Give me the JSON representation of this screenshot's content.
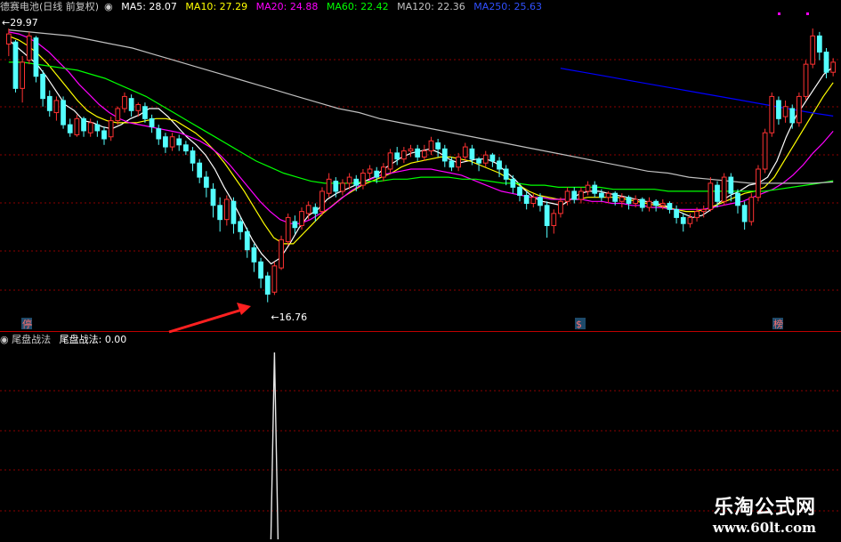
{
  "header": {
    "stock_title": "德赛电池(日线 前复权)",
    "ma_items": [
      {
        "label": "MA5",
        "value": "28.07",
        "color": "#ffffff"
      },
      {
        "label": "MA10",
        "value": "27.29",
        "color": "#ffff00"
      },
      {
        "label": "MA20",
        "value": "24.88",
        "color": "#ff00ff"
      },
      {
        "label": "MA60",
        "value": "22.42",
        "color": "#00ff00"
      },
      {
        "label": "MA120",
        "value": "22.36",
        "color": "#c0c0c0"
      },
      {
        "label": "MA250",
        "value": "25.63",
        "color": "#0000ff"
      }
    ]
  },
  "price_labels": {
    "high": "29.97",
    "low": "16.76"
  },
  "markers": {
    "left_badge": "停",
    "mid_badge": "$",
    "right_badge": "榜"
  },
  "indicator": {
    "name": "尾盘战法",
    "value_label": "尾盘战法",
    "value": "0.00"
  },
  "watermark": {
    "line1": "乐淘公式网",
    "line2": "www.60lt.com"
  },
  "colors": {
    "up": "#ff3232",
    "down": "#54ffff",
    "grid": "#8b0000",
    "divider": "#c00000",
    "arrow": "#ff2020"
  },
  "chart_data": {
    "type": "candlestick",
    "ylim": [
      15.5,
      30.5
    ],
    "grid": true,
    "candles": [
      [
        29.2,
        29.7,
        28.6,
        29.97
      ],
      [
        29.3,
        27.0,
        26.8,
        29.4
      ],
      [
        27.0,
        28.3,
        26.3,
        28.6
      ],
      [
        28.4,
        29.6,
        28.2,
        29.8
      ],
      [
        29.5,
        27.6,
        27.3,
        29.6
      ],
      [
        27.7,
        26.5,
        26.1,
        27.9
      ],
      [
        26.6,
        25.9,
        25.6,
        26.9
      ],
      [
        25.8,
        26.4,
        25.4,
        26.6
      ],
      [
        26.4,
        25.2,
        25.0,
        26.6
      ],
      [
        25.2,
        24.8,
        24.6,
        25.5
      ],
      [
        24.7,
        25.5,
        24.6,
        25.7
      ],
      [
        25.5,
        24.9,
        24.6,
        25.6
      ],
      [
        24.8,
        25.3,
        24.6,
        25.5
      ],
      [
        25.2,
        24.9,
        24.6,
        25.4
      ],
      [
        24.9,
        24.5,
        24.2,
        25.1
      ],
      [
        24.6,
        25.4,
        24.4,
        25.6
      ],
      [
        25.4,
        26.0,
        25.2,
        26.1
      ],
      [
        26.0,
        26.6,
        25.8,
        26.8
      ],
      [
        26.5,
        25.9,
        25.6,
        26.7
      ],
      [
        25.9,
        26.2,
        25.6,
        26.3
      ],
      [
        26.1,
        25.5,
        25.3,
        26.3
      ],
      [
        25.5,
        25.1,
        24.8,
        25.7
      ],
      [
        25.0,
        24.5,
        24.2,
        25.2
      ],
      [
        24.6,
        24.1,
        23.8,
        24.8
      ],
      [
        24.1,
        24.6,
        23.9,
        24.8
      ],
      [
        24.5,
        24.2,
        23.9,
        24.7
      ],
      [
        24.2,
        23.9,
        23.7,
        24.4
      ],
      [
        23.9,
        23.3,
        22.9,
        24.1
      ],
      [
        23.3,
        22.6,
        22.3,
        23.5
      ],
      [
        22.6,
        22.1,
        21.6,
        22.9
      ],
      [
        22.0,
        21.2,
        20.6,
        22.3
      ],
      [
        21.2,
        20.5,
        19.9,
        21.6
      ],
      [
        20.5,
        21.5,
        20.2,
        21.7
      ],
      [
        21.4,
        20.3,
        19.8,
        21.6
      ],
      [
        20.4,
        19.9,
        19.5,
        20.6
      ],
      [
        19.9,
        19.0,
        18.6,
        20.1
      ],
      [
        19.1,
        18.4,
        17.9,
        19.3
      ],
      [
        18.4,
        17.6,
        17.1,
        18.6
      ],
      [
        17.7,
        16.8,
        16.4,
        17.9
      ],
      [
        16.9,
        18.2,
        16.76,
        18.4
      ],
      [
        18.1,
        19.5,
        18.0,
        19.7
      ],
      [
        19.4,
        20.6,
        19.2,
        20.8
      ],
      [
        20.4,
        20.1,
        19.8,
        20.7
      ],
      [
        20.2,
        20.9,
        20.0,
        21.1
      ],
      [
        20.8,
        21.2,
        20.5,
        21.4
      ],
      [
        21.1,
        20.8,
        20.4,
        21.3
      ],
      [
        20.9,
        21.9,
        20.7,
        22.1
      ],
      [
        21.8,
        22.5,
        21.6,
        22.8
      ],
      [
        22.4,
        21.9,
        21.6,
        22.6
      ],
      [
        21.9,
        22.3,
        21.7,
        22.5
      ],
      [
        22.3,
        22.6,
        22.0,
        22.8
      ],
      [
        22.5,
        22.2,
        21.9,
        22.7
      ],
      [
        22.2,
        22.8,
        22.0,
        23.0
      ],
      [
        22.8,
        23.0,
        22.5,
        23.2
      ],
      [
        22.9,
        22.6,
        22.3,
        23.1
      ],
      [
        22.6,
        23.1,
        22.4,
        23.3
      ],
      [
        23.0,
        23.8,
        22.8,
        24.0
      ],
      [
        23.8,
        23.5,
        23.2,
        24.1
      ],
      [
        23.5,
        23.9,
        23.3,
        24.1
      ],
      [
        23.9,
        24.0,
        23.6,
        24.2
      ],
      [
        24.0,
        23.6,
        23.4,
        24.2
      ],
      [
        23.6,
        23.9,
        23.4,
        24.2
      ],
      [
        23.9,
        24.4,
        23.7,
        24.6
      ],
      [
        24.3,
        24.0,
        23.6,
        24.5
      ],
      [
        24.0,
        23.4,
        23.1,
        24.2
      ],
      [
        23.4,
        23.1,
        22.9,
        23.6
      ],
      [
        23.1,
        23.6,
        22.9,
        23.8
      ],
      [
        23.6,
        24.1,
        23.4,
        24.3
      ],
      [
        24.0,
        23.5,
        23.2,
        24.2
      ],
      [
        23.5,
        23.3,
        22.9,
        23.6
      ],
      [
        23.3,
        23.7,
        23.1,
        23.9
      ],
      [
        23.7,
        23.4,
        23.1,
        23.8
      ],
      [
        23.4,
        23.0,
        22.6,
        23.6
      ],
      [
        23.0,
        22.5,
        22.2,
        23.2
      ],
      [
        22.5,
        22.1,
        21.8,
        22.7
      ],
      [
        22.1,
        21.7,
        21.4,
        22.3
      ],
      [
        21.7,
        21.3,
        21.0,
        21.9
      ],
      [
        21.3,
        21.6,
        21.1,
        21.8
      ],
      [
        21.6,
        21.2,
        20.9,
        21.8
      ],
      [
        21.2,
        20.2,
        19.6,
        21.4
      ],
      [
        20.2,
        20.8,
        19.8,
        21.0
      ],
      [
        20.8,
        21.4,
        20.6,
        21.6
      ],
      [
        21.4,
        21.9,
        21.2,
        22.1
      ],
      [
        21.9,
        21.5,
        21.3,
        22.1
      ],
      [
        21.5,
        21.9,
        21.3,
        22.1
      ],
      [
        21.9,
        22.2,
        21.7,
        22.4
      ],
      [
        22.2,
        21.8,
        21.6,
        22.4
      ],
      [
        21.8,
        21.6,
        21.4,
        22.0
      ],
      [
        21.6,
        21.8,
        21.3,
        21.9
      ],
      [
        21.8,
        21.4,
        21.2,
        21.9
      ],
      [
        21.4,
        21.6,
        21.1,
        21.8
      ],
      [
        21.6,
        21.3,
        21.0,
        21.7
      ],
      [
        21.3,
        21.5,
        21.1,
        21.7
      ],
      [
        21.5,
        21.1,
        20.9,
        21.6
      ],
      [
        21.1,
        21.4,
        20.9,
        21.6
      ],
      [
        21.4,
        21.2,
        20.9,
        21.5
      ],
      [
        21.2,
        21.3,
        21.0,
        21.5
      ],
      [
        21.3,
        21.0,
        20.8,
        21.4
      ],
      [
        21.0,
        20.6,
        20.3,
        21.2
      ],
      [
        20.6,
        20.3,
        19.9,
        20.8
      ],
      [
        20.3,
        20.6,
        20.1,
        20.8
      ],
      [
        20.6,
        20.9,
        20.4,
        21.1
      ],
      [
        20.9,
        21.0,
        20.6,
        21.2
      ],
      [
        21.0,
        22.3,
        20.9,
        22.6
      ],
      [
        22.2,
        21.4,
        21.1,
        22.4
      ],
      [
        21.4,
        22.6,
        21.2,
        22.8
      ],
      [
        22.6,
        21.8,
        21.4,
        22.8
      ],
      [
        21.8,
        21.2,
        20.8,
        22.0
      ],
      [
        21.2,
        20.4,
        20.0,
        21.4
      ],
      [
        20.4,
        21.6,
        20.2,
        21.8
      ],
      [
        21.6,
        23.0,
        21.4,
        23.2
      ],
      [
        23.0,
        24.8,
        22.8,
        25.0
      ],
      [
        24.8,
        26.6,
        24.6,
        26.8
      ],
      [
        26.4,
        25.5,
        25.2,
        26.6
      ],
      [
        25.6,
        26.1,
        25.3,
        26.4
      ],
      [
        26.0,
        25.3,
        25.0,
        26.2
      ],
      [
        25.3,
        26.6,
        25.1,
        26.8
      ],
      [
        26.6,
        28.2,
        26.4,
        28.4
      ],
      [
        28.2,
        29.6,
        28.0,
        29.97
      ],
      [
        29.6,
        28.8,
        28.4,
        29.8
      ],
      [
        28.8,
        27.8,
        27.5,
        29.0
      ],
      [
        27.8,
        28.3,
        27.6,
        28.5
      ]
    ],
    "moving_averages": [
      {
        "name": "MA5",
        "color": "#ffffff",
        "points": [
          29.4,
          29.0,
          28.6,
          28.2,
          27.6,
          26.9,
          26.2,
          25.9,
          25.4,
          25.3,
          25.1,
          25.0,
          25.2,
          25.5,
          25.7,
          26.0,
          26.0,
          25.6,
          25.1,
          24.6,
          24.2,
          23.7,
          23.0,
          22.1,
          21.3,
          20.4,
          19.5,
          18.8,
          18.3,
          18.6,
          19.3,
          20.1,
          20.7,
          21.0,
          21.5,
          21.8,
          22.0,
          22.2,
          22.4,
          22.6,
          23.0,
          23.3,
          23.6,
          23.8,
          23.9,
          24.0,
          23.8,
          23.5,
          23.3,
          23.4,
          23.5,
          23.5,
          23.3,
          22.9,
          22.5,
          22.0,
          21.6,
          21.4,
          21.3,
          21.2,
          21.5,
          21.8,
          21.9,
          21.9,
          21.8,
          21.7,
          21.6,
          21.5,
          21.4,
          21.3,
          21.2,
          21.0,
          20.8,
          20.6,
          20.7,
          21.0,
          21.4,
          21.7,
          21.9,
          22.2,
          22.3,
          22.6,
          23.4,
          24.6,
          25.6,
          26.3,
          27.0,
          27.7,
          28.07
        ]
      },
      {
        "name": "MA10",
        "color": "#ffff00",
        "points": [
          29.6,
          29.4,
          29.1,
          28.7,
          28.2,
          27.6,
          27.0,
          26.4,
          25.9,
          25.6,
          25.4,
          25.3,
          25.3,
          25.3,
          25.4,
          25.5,
          25.5,
          25.4,
          25.1,
          24.8,
          24.4,
          23.9,
          23.3,
          22.6,
          21.9,
          21.1,
          20.3,
          19.6,
          19.3,
          19.3,
          19.8,
          20.3,
          20.8,
          21.2,
          21.6,
          21.9,
          22.2,
          22.4,
          22.6,
          22.8,
          23.1,
          23.3,
          23.4,
          23.5,
          23.6,
          23.6,
          23.5,
          23.4,
          23.2,
          23.0,
          22.8,
          22.5,
          22.2,
          21.9,
          21.7,
          21.6,
          21.5,
          21.5,
          21.5,
          21.6,
          21.6,
          21.6,
          21.6,
          21.5,
          21.4,
          21.3,
          21.2,
          21.1,
          21.0,
          20.9,
          20.9,
          21.0,
          21.2,
          21.4,
          21.6,
          21.8,
          21.9,
          22.1,
          22.6,
          23.4,
          24.2,
          25.0,
          25.8,
          26.6,
          27.29
        ]
      },
      {
        "name": "MA20",
        "color": "#ff00ff",
        "points": [
          29.8,
          29.7,
          29.5,
          29.2,
          28.8,
          28.3,
          27.8,
          27.2,
          26.7,
          26.2,
          25.8,
          25.5,
          25.3,
          25.2,
          25.1,
          25.0,
          24.9,
          24.8,
          24.6,
          24.4,
          24.1,
          23.7,
          23.2,
          22.6,
          22.0,
          21.4,
          20.9,
          20.5,
          20.3,
          20.3,
          20.5,
          20.8,
          21.1,
          21.5,
          21.9,
          22.2,
          22.5,
          22.7,
          22.8,
          22.9,
          23.0,
          23.0,
          23.0,
          22.9,
          22.8,
          22.7,
          22.5,
          22.3,
          22.1,
          21.9,
          21.8,
          21.7,
          21.6,
          21.6,
          21.5,
          21.5,
          21.5,
          21.5,
          21.4,
          21.4,
          21.3,
          21.3,
          21.2,
          21.2,
          21.1,
          21.1,
          21.0,
          21.0,
          21.0,
          21.0,
          21.1,
          21.2,
          21.3,
          21.4,
          21.6,
          21.8,
          22.0,
          22.3,
          22.7,
          23.2,
          23.8,
          24.3,
          24.88
        ]
      },
      {
        "name": "MA60",
        "color": "#00ff00",
        "points": [
          28.3,
          28.3,
          28.2,
          28.1,
          28.0,
          27.9,
          27.7,
          27.5,
          27.2,
          26.9,
          26.6,
          26.2,
          25.8,
          25.4,
          25.0,
          24.6,
          24.2,
          23.8,
          23.4,
          23.1,
          22.8,
          22.6,
          22.4,
          22.3,
          22.3,
          22.3,
          22.4,
          22.4,
          22.5,
          22.5,
          22.6,
          22.6,
          22.6,
          22.5,
          22.5,
          22.4,
          22.3,
          22.3,
          22.2,
          22.2,
          22.1,
          22.1,
          22.1,
          22.1,
          22.0,
          22.0,
          22.0,
          22.0,
          21.9,
          21.9,
          21.9,
          21.9,
          21.9,
          21.9,
          21.9,
          21.9,
          22.0,
          22.1,
          22.2,
          22.3,
          22.42
        ]
      },
      {
        "name": "MA120",
        "color": "#c0c0c0",
        "points": [
          29.9,
          29.8,
          29.7,
          29.6,
          29.4,
          29.2,
          29.0,
          28.7,
          28.4,
          28.1,
          27.8,
          27.5,
          27.2,
          26.9,
          26.6,
          26.3,
          26.0,
          25.8,
          25.5,
          25.3,
          25.1,
          24.9,
          24.7,
          24.5,
          24.3,
          24.1,
          23.9,
          23.7,
          23.5,
          23.3,
          23.1,
          22.9,
          22.8,
          22.6,
          22.5,
          22.4,
          22.3,
          22.3,
          22.3,
          22.3,
          22.36
        ]
      },
      {
        "name": "MA250",
        "color": "#0000ff",
        "points": [
          28.0,
          27.8,
          27.6,
          27.4,
          27.2,
          27.0,
          26.8,
          26.6,
          26.4,
          26.2,
          26.0,
          25.8,
          25.63
        ]
      }
    ],
    "indicator_series": {
      "name": "尾盘战法",
      "spike_candle_index": 39,
      "spike_value": 1,
      "baseline": 0
    }
  }
}
